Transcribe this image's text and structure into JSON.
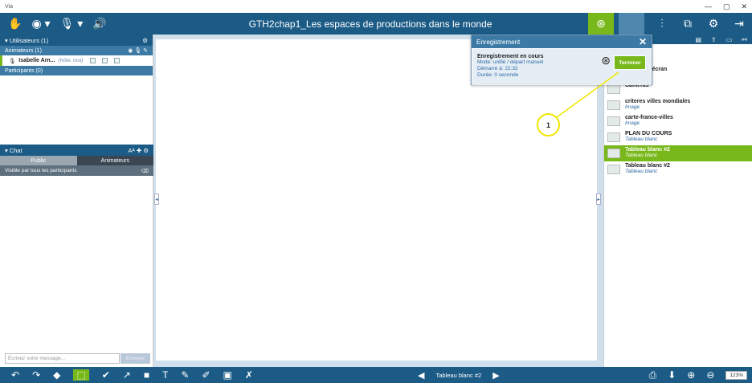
{
  "window": {
    "title": "Via",
    "min": "—",
    "max": "▢",
    "close": "✕"
  },
  "topbar": {
    "title": "GTH2chap1_Les espaces de productions dans le monde",
    "left_icons": [
      "hand-icon",
      "webcam-icon",
      "mic-icon",
      "speaker-icon"
    ],
    "left_glyphs": [
      "✋",
      "◉ ▾",
      "🎙 ▾",
      "🔊"
    ],
    "right_glyphs": [
      "⊛",
      "⫶",
      "⧉",
      "⚙",
      "⇥"
    ],
    "accent": "#78b81a",
    "bar_color": "#1b5b86"
  },
  "users": {
    "header": "▾ Utilisateurs (1)",
    "animators_label": "Animateurs (1)",
    "user_name": "Isabelle Arn...",
    "user_role": "(hôte, moi)",
    "participants_label": "Participants (0)"
  },
  "chat": {
    "header": "▾ Chat",
    "tab_public": "Public",
    "tab_animators": "Animateurs",
    "visibility": "Visible par tous les participants",
    "placeholder": "Écrivez votre message...",
    "send": "Envoyer"
  },
  "recording": {
    "title": "Enregistrement",
    "close": "✕",
    "status": "Enregistrement en cours",
    "mode": "Mode: unifié / départ manuel",
    "started": "Démarré à: 22:32",
    "duration": "Durée: 0 seconde",
    "finish_button": "Terminer"
  },
  "callout": "1",
  "documents": [
    {
      "name": "Partage d'écran",
      "type": ""
    },
    {
      "name": "Caméras",
      "type": ""
    },
    {
      "name": "criteres villes mondiales",
      "type": "Image"
    },
    {
      "name": "carte-france-villes",
      "type": "Image"
    },
    {
      "name": "PLAN DU COURS",
      "type": "Tableau blanc"
    },
    {
      "name": "Tableau blanc #2",
      "type": "Tableau blanc"
    },
    {
      "name": "Tableau blanc #2",
      "type": "Tableau blanc"
    }
  ],
  "bottombar": {
    "page_name": "Tableau blanc #2",
    "zoom": "123%",
    "tools": [
      "↶",
      "↷",
      "◆",
      "⬚",
      "✔",
      "↗",
      "■",
      "T",
      "✎",
      "✐",
      "▣",
      "✗"
    ]
  }
}
